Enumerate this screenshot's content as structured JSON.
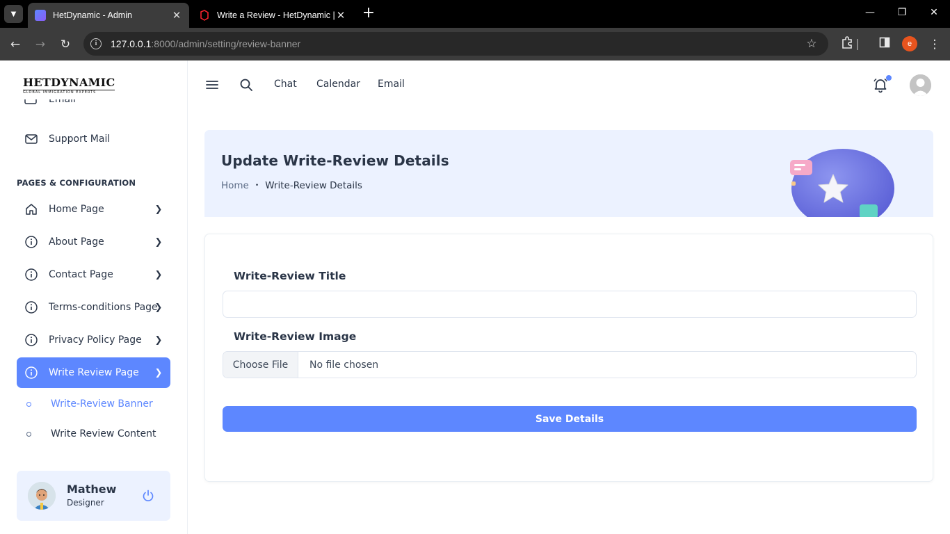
{
  "browser": {
    "tabs": [
      {
        "title": "HetDynamic - Admin",
        "active": true
      },
      {
        "title": "Write a Review - HetDynamic | I",
        "active": false
      }
    ],
    "url_host": "127.0.0.1",
    "url_rest": ":8000/admin/setting/review-banner",
    "profile_initial": "e"
  },
  "sidebar": {
    "logo_main": "HETDYNAMIC",
    "logo_tagline": "GLOBAL IMMIGRATION EXPERTS",
    "clipped_item": "Email",
    "support_mail": "Support Mail",
    "section_title": "PAGES & CONFIGURATION",
    "items": [
      {
        "label": "Home Page"
      },
      {
        "label": "About Page"
      },
      {
        "label": "Contact Page"
      },
      {
        "label": "Terms-conditions Page"
      },
      {
        "label": "Privacy Policy Page"
      },
      {
        "label": "Write Review Page"
      }
    ],
    "sub_items": [
      {
        "label": "Write-Review Banner"
      },
      {
        "label": "Write Review Content"
      }
    ],
    "user": {
      "name": "Mathew",
      "role": "Designer"
    }
  },
  "header": {
    "links": [
      "Chat",
      "Calendar",
      "Email"
    ]
  },
  "banner": {
    "title": "Update Write-Review Details",
    "breadcrumb_home": "Home",
    "breadcrumb_sep": "•",
    "breadcrumb_current": "Write-Review Details"
  },
  "form": {
    "title_label": "Write-Review Title",
    "title_value": "",
    "image_label": "Write-Review Image",
    "file_button": "Choose File",
    "file_status": "No file chosen",
    "save_label": "Save Details"
  },
  "colors": {
    "primary": "#5d87ff",
    "text": "#2a3547",
    "banner_bg": "#ecf2ff"
  }
}
